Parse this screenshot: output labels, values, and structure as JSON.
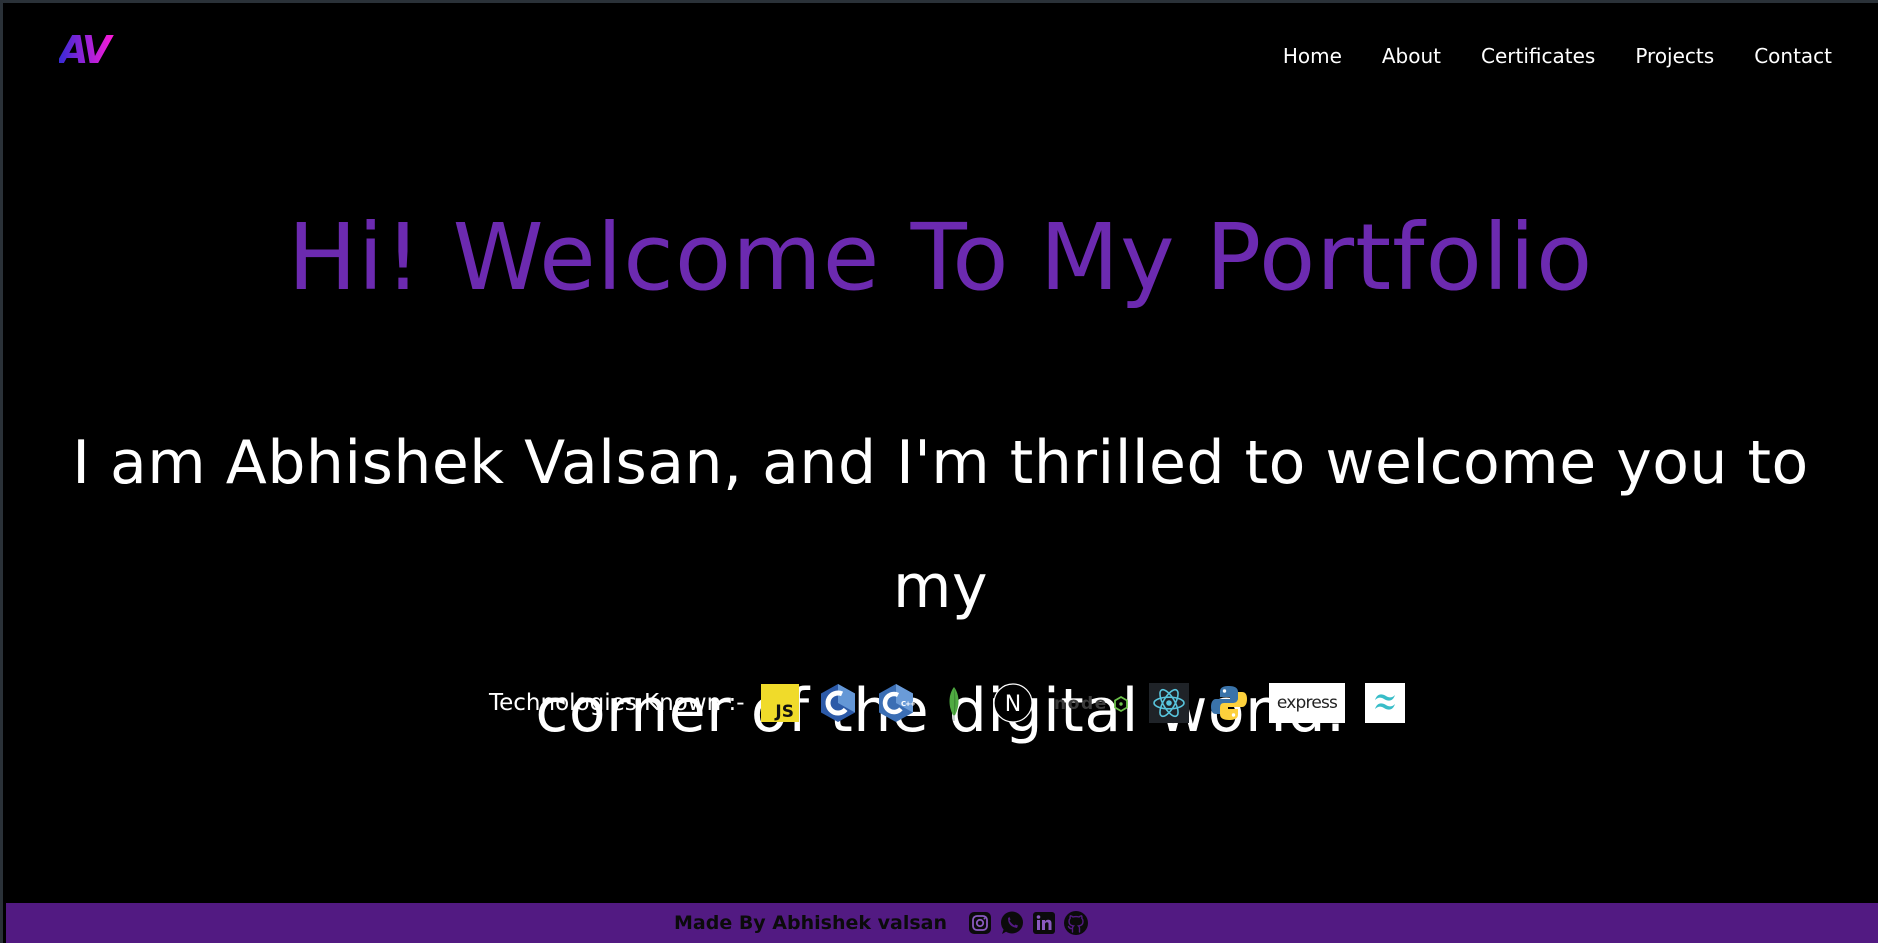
{
  "brand": {
    "logo_text": "AV",
    "colors": {
      "start": "#2b2bd4",
      "end": "#ff1ad9"
    }
  },
  "nav": {
    "items": [
      {
        "label": "Home"
      },
      {
        "label": "About"
      },
      {
        "label": "Certificates"
      },
      {
        "label": "Projects"
      },
      {
        "label": "Contact"
      }
    ]
  },
  "hero": {
    "title": "Hi! Welcome To My Portfolio",
    "intro_line1": "I am Abhishek Valsan, and I'm thrilled to welcome you to my",
    "intro_line2": "corner of the digital world."
  },
  "tech": {
    "label": "Technologies Known :-",
    "icons": [
      {
        "name": "javascript-icon",
        "text": "JS"
      },
      {
        "name": "c-icon",
        "text": "C"
      },
      {
        "name": "cpp-icon",
        "text": "C++"
      },
      {
        "name": "mongodb-icon"
      },
      {
        "name": "nextjs-icon",
        "text": "N"
      },
      {
        "name": "nodejs-icon",
        "text": "node"
      },
      {
        "name": "react-icon"
      },
      {
        "name": "python-icon"
      },
      {
        "name": "express-icon",
        "text": "express"
      },
      {
        "name": "tailwind-icon"
      }
    ]
  },
  "footer": {
    "text": "Made By Abhishek valsan",
    "social": [
      "instagram-icon",
      "whatsapp-icon",
      "linkedin-icon",
      "github-icon"
    ]
  },
  "colors": {
    "background": "#000000",
    "accent_purple": "#6c2ab0",
    "footer_bg": "#521a82"
  }
}
